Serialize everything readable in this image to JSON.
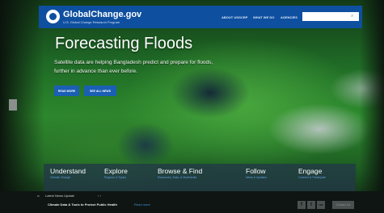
{
  "header": {
    "logo_title": "GlobalChange.gov",
    "logo_subtitle": "U.S. Global Change Research Program",
    "nav": [
      "ABOUT USGCRP",
      "WHAT WE DO",
      "AGENCIES"
    ],
    "search": {
      "value": "",
      "placeholder": ""
    }
  },
  "hero": {
    "title": "Forecasting Floods",
    "description": "Satellite data are helping Bangladesh predict and prepare for floods, further in advance than ever before.",
    "buttons": [
      "READ MORE",
      "SEE ALL NEWS"
    ]
  },
  "features": [
    {
      "title": "Understand",
      "sub": "Climate Change"
    },
    {
      "title": "Explore",
      "sub": "Regions & Topics"
    },
    {
      "title": "Browse & Find",
      "sub": "Resources, Data, & Multimedia"
    },
    {
      "title": "Follow",
      "sub": "News & Updates"
    },
    {
      "title": "Engage",
      "sub": "Connect & Participate"
    }
  ],
  "footer": {
    "news_label": "Latest News Update",
    "news_arrows": "‹ ›",
    "news_title": "Climate Data & Tools to Protect Public Health",
    "news_link": "Read more",
    "social": [
      "f",
      "t",
      "rss"
    ],
    "contact_label": "Contact Us"
  },
  "icons": {
    "search": "search-icon",
    "logo": "globe-logo-icon"
  },
  "colors": {
    "header_blue": "#0e4fa0",
    "button_blue": "#1a5fb4",
    "link_blue": "#3f8fd6"
  }
}
